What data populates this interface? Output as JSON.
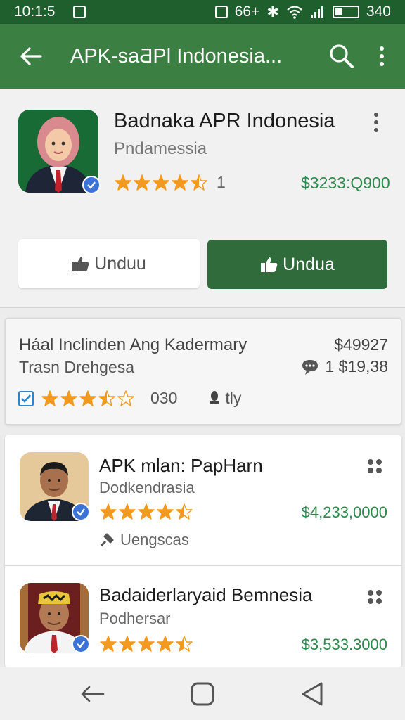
{
  "status_bar": {
    "time": "10:1:5",
    "notif_count": "66+",
    "battery_text": "340"
  },
  "app_bar": {
    "title": "APK-saƋPl Indonesia..."
  },
  "hero": {
    "title": "Badnaka APR Indonesia",
    "subtitle": "Pndamessia",
    "rating_stars": 4.5,
    "rating_count": "1",
    "price": "$3233:Q900",
    "button_secondary": "Unduu",
    "button_primary": "Undua"
  },
  "featured": {
    "title": "Háal  Inclinden  Ang Kadermary",
    "subtitle": "Trasn Drehgesa",
    "price": "$49927",
    "comment_value": "1 $19,38",
    "rating_stars": 3.5,
    "count": "030",
    "user_label": "tly"
  },
  "items": [
    {
      "title": "APK mlan: PapHarn",
      "subtitle": "Dodkendrasia",
      "rating_stars": 4.5,
      "price": "$4,233,0000",
      "tag": "Uengscas"
    },
    {
      "title": "Badaiderlaryaid Bemnesia",
      "subtitle": "Podhersar",
      "rating_stars": 4.5,
      "price": "$3,533.3000"
    }
  ],
  "colors": {
    "app_bar": "#3c7f43",
    "status_bar": "#1f5f2d",
    "primary_button": "#2f6b3b",
    "price_green": "#2d8a4c",
    "star": "#f29a1f",
    "verify_badge": "#3b74d6"
  }
}
